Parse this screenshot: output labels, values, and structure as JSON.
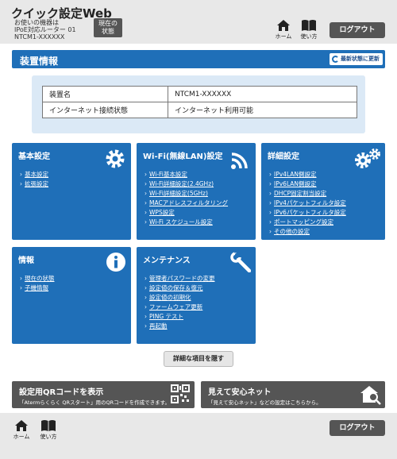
{
  "header": {
    "title": "クイック設定Web",
    "device_line1": "お使いの機器は",
    "device_line2": "IPoE対応ルーター 01",
    "device_line3": "NTCM1-XXXXXX",
    "current_status_line1": "現在の",
    "current_status_line2": "状態",
    "home_label": "ホーム",
    "manual_label": "使い方",
    "logout_label": "ログアウト"
  },
  "device_section": {
    "title": "装置情報",
    "refresh_label": "最新状態に更新",
    "rows": [
      {
        "key": "装置名",
        "value": "NTCM1-XXXXXX"
      },
      {
        "key": "インターネット接続状態",
        "value": "インターネット利用可能"
      }
    ]
  },
  "cards": {
    "basic": {
      "title": "基本設定",
      "items": [
        "基本設定",
        "拡張設定"
      ]
    },
    "wifi": {
      "title": "Wi-Fi(無線LAN)設定",
      "items": [
        "Wi-Fi基本設定",
        "Wi-Fi詳細設定(2.4GHz)",
        "Wi-Fi詳細設定(5GHz)",
        "MACアドレスフィルタリング",
        "WPS設定",
        "Wi-Fi スケジュール設定"
      ]
    },
    "advanced": {
      "title": "詳細設定",
      "items": [
        "IPv4LAN側設定",
        "IPv6LAN側設定",
        "DHCP固定割当設定",
        "IPv4パケットフィルタ設定",
        "IPv6パケットフィルタ設定",
        "ポートマッピング設定",
        "その他の設定"
      ]
    },
    "info": {
      "title": "情報",
      "items": [
        "現在の状態",
        "子機情報"
      ]
    },
    "maintenance": {
      "title": "メンテナンス",
      "items": [
        "管理者パスワードの変更",
        "設定値の保存＆復元",
        "設定値の初期化",
        "ファームウェア更新",
        "PING テスト",
        "再起動"
      ]
    }
  },
  "toggle_label": "詳細な項目を隠す",
  "promos": {
    "qr": {
      "title": "設定用QRコードを表示",
      "subtitle": "「Atermらくらく QRスタート」用のQRコードを作成できます。"
    },
    "anshin": {
      "title": "見えて安心ネット",
      "subtitle": "「見えて安心ネット」などの設定はこちらから。"
    }
  },
  "footer": {
    "home_label": "ホーム",
    "manual_label": "使い方",
    "logout_label": "ログアウト"
  },
  "colors": {
    "primary": "#1f6fb8",
    "dark_button": "#555555",
    "panel_bg": "#dbe9f6"
  }
}
